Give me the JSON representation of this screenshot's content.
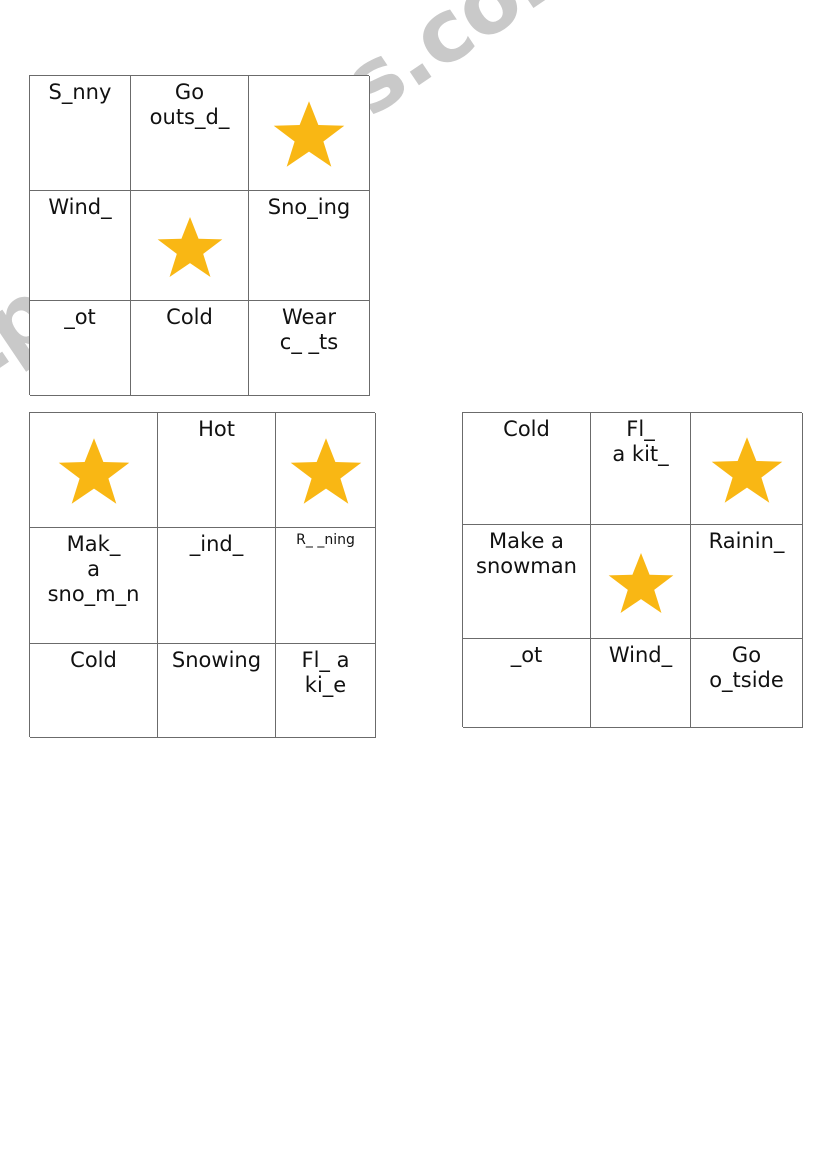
{
  "document": {
    "type": "bingo-worksheet",
    "topic": "Weather and winter activities bingo cards",
    "watermark": "ESLprintables.com",
    "background_color": "#ffffff",
    "grid_line_color": "#6b6b6b",
    "star_color": "#f9b714",
    "text_color": "#111111"
  },
  "cards": [
    {
      "id": "card-1",
      "position": "top-left",
      "rows": [
        [
          {
            "kind": "text",
            "text": "S_nny"
          },
          {
            "kind": "text",
            "text": "Go\nouts_d_"
          },
          {
            "kind": "star",
            "icon": "star-icon",
            "size": "lg"
          }
        ],
        [
          {
            "kind": "text",
            "text": "Wind_"
          },
          {
            "kind": "star",
            "icon": "star-icon",
            "size": "md"
          },
          {
            "kind": "text",
            "text": "Sno_ing"
          }
        ],
        [
          {
            "kind": "text",
            "text": "_ot"
          },
          {
            "kind": "text",
            "text": "Cold"
          },
          {
            "kind": "text",
            "text": "Wear\nc_ _ts"
          }
        ]
      ]
    },
    {
      "id": "card-2",
      "position": "bottom-left",
      "rows": [
        [
          {
            "kind": "star",
            "icon": "star-icon",
            "size": "lg"
          },
          {
            "kind": "text",
            "text": "Hot"
          },
          {
            "kind": "star",
            "icon": "star-icon",
            "size": "lg"
          }
        ],
        [
          {
            "kind": "text",
            "text": "Mak_\na\nsno_m_n"
          },
          {
            "kind": "text",
            "text": "_ind_"
          },
          {
            "kind": "text",
            "text": "R_ _ning",
            "size": "small"
          }
        ],
        [
          {
            "kind": "text",
            "text": "Cold"
          },
          {
            "kind": "text",
            "text": "Snowing"
          },
          {
            "kind": "text",
            "text": "Fl_  a\nki_e"
          }
        ]
      ]
    },
    {
      "id": "card-3",
      "position": "bottom-right",
      "rows": [
        [
          {
            "kind": "text",
            "text": "Cold"
          },
          {
            "kind": "text",
            "text": "Fl_\na kit_"
          },
          {
            "kind": "star",
            "icon": "star-icon",
            "size": "lg"
          }
        ],
        [
          {
            "kind": "text",
            "text": "Make a\nsnowman"
          },
          {
            "kind": "star",
            "icon": "star-icon",
            "size": "md"
          },
          {
            "kind": "text",
            "text": "Rainin_"
          }
        ],
        [
          {
            "kind": "text",
            "text": "_ot"
          },
          {
            "kind": "text",
            "text": "Wind_"
          },
          {
            "kind": "text",
            "text": "Go\no_tside"
          }
        ]
      ]
    }
  ]
}
